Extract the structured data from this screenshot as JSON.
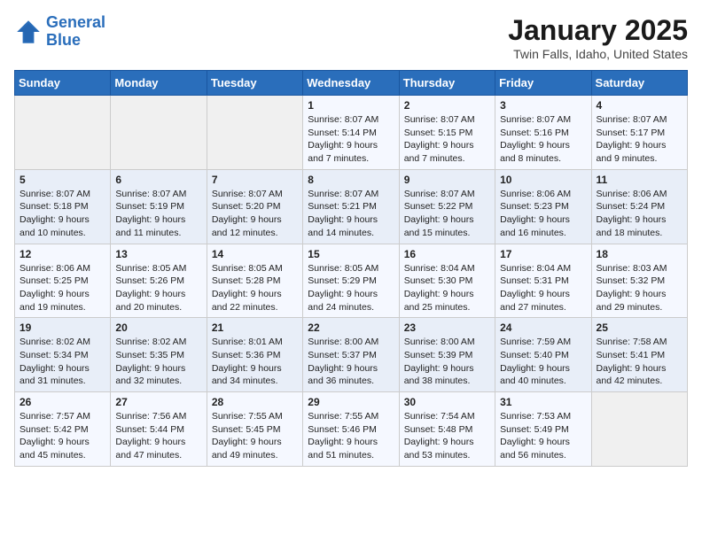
{
  "header": {
    "logo_line1": "General",
    "logo_line2": "Blue",
    "title": "January 2025",
    "subtitle": "Twin Falls, Idaho, United States"
  },
  "weekdays": [
    "Sunday",
    "Monday",
    "Tuesday",
    "Wednesday",
    "Thursday",
    "Friday",
    "Saturday"
  ],
  "weeks": [
    [
      {
        "day": "",
        "info": ""
      },
      {
        "day": "",
        "info": ""
      },
      {
        "day": "",
        "info": ""
      },
      {
        "day": "1",
        "info": "Sunrise: 8:07 AM\nSunset: 5:14 PM\nDaylight: 9 hours\nand 7 minutes."
      },
      {
        "day": "2",
        "info": "Sunrise: 8:07 AM\nSunset: 5:15 PM\nDaylight: 9 hours\nand 7 minutes."
      },
      {
        "day": "3",
        "info": "Sunrise: 8:07 AM\nSunset: 5:16 PM\nDaylight: 9 hours\nand 8 minutes."
      },
      {
        "day": "4",
        "info": "Sunrise: 8:07 AM\nSunset: 5:17 PM\nDaylight: 9 hours\nand 9 minutes."
      }
    ],
    [
      {
        "day": "5",
        "info": "Sunrise: 8:07 AM\nSunset: 5:18 PM\nDaylight: 9 hours\nand 10 minutes."
      },
      {
        "day": "6",
        "info": "Sunrise: 8:07 AM\nSunset: 5:19 PM\nDaylight: 9 hours\nand 11 minutes."
      },
      {
        "day": "7",
        "info": "Sunrise: 8:07 AM\nSunset: 5:20 PM\nDaylight: 9 hours\nand 12 minutes."
      },
      {
        "day": "8",
        "info": "Sunrise: 8:07 AM\nSunset: 5:21 PM\nDaylight: 9 hours\nand 14 minutes."
      },
      {
        "day": "9",
        "info": "Sunrise: 8:07 AM\nSunset: 5:22 PM\nDaylight: 9 hours\nand 15 minutes."
      },
      {
        "day": "10",
        "info": "Sunrise: 8:06 AM\nSunset: 5:23 PM\nDaylight: 9 hours\nand 16 minutes."
      },
      {
        "day": "11",
        "info": "Sunrise: 8:06 AM\nSunset: 5:24 PM\nDaylight: 9 hours\nand 18 minutes."
      }
    ],
    [
      {
        "day": "12",
        "info": "Sunrise: 8:06 AM\nSunset: 5:25 PM\nDaylight: 9 hours\nand 19 minutes."
      },
      {
        "day": "13",
        "info": "Sunrise: 8:05 AM\nSunset: 5:26 PM\nDaylight: 9 hours\nand 20 minutes."
      },
      {
        "day": "14",
        "info": "Sunrise: 8:05 AM\nSunset: 5:28 PM\nDaylight: 9 hours\nand 22 minutes."
      },
      {
        "day": "15",
        "info": "Sunrise: 8:05 AM\nSunset: 5:29 PM\nDaylight: 9 hours\nand 24 minutes."
      },
      {
        "day": "16",
        "info": "Sunrise: 8:04 AM\nSunset: 5:30 PM\nDaylight: 9 hours\nand 25 minutes."
      },
      {
        "day": "17",
        "info": "Sunrise: 8:04 AM\nSunset: 5:31 PM\nDaylight: 9 hours\nand 27 minutes."
      },
      {
        "day": "18",
        "info": "Sunrise: 8:03 AM\nSunset: 5:32 PM\nDaylight: 9 hours\nand 29 minutes."
      }
    ],
    [
      {
        "day": "19",
        "info": "Sunrise: 8:02 AM\nSunset: 5:34 PM\nDaylight: 9 hours\nand 31 minutes."
      },
      {
        "day": "20",
        "info": "Sunrise: 8:02 AM\nSunset: 5:35 PM\nDaylight: 9 hours\nand 32 minutes."
      },
      {
        "day": "21",
        "info": "Sunrise: 8:01 AM\nSunset: 5:36 PM\nDaylight: 9 hours\nand 34 minutes."
      },
      {
        "day": "22",
        "info": "Sunrise: 8:00 AM\nSunset: 5:37 PM\nDaylight: 9 hours\nand 36 minutes."
      },
      {
        "day": "23",
        "info": "Sunrise: 8:00 AM\nSunset: 5:39 PM\nDaylight: 9 hours\nand 38 minutes."
      },
      {
        "day": "24",
        "info": "Sunrise: 7:59 AM\nSunset: 5:40 PM\nDaylight: 9 hours\nand 40 minutes."
      },
      {
        "day": "25",
        "info": "Sunrise: 7:58 AM\nSunset: 5:41 PM\nDaylight: 9 hours\nand 42 minutes."
      }
    ],
    [
      {
        "day": "26",
        "info": "Sunrise: 7:57 AM\nSunset: 5:42 PM\nDaylight: 9 hours\nand 45 minutes."
      },
      {
        "day": "27",
        "info": "Sunrise: 7:56 AM\nSunset: 5:44 PM\nDaylight: 9 hours\nand 47 minutes."
      },
      {
        "day": "28",
        "info": "Sunrise: 7:55 AM\nSunset: 5:45 PM\nDaylight: 9 hours\nand 49 minutes."
      },
      {
        "day": "29",
        "info": "Sunrise: 7:55 AM\nSunset: 5:46 PM\nDaylight: 9 hours\nand 51 minutes."
      },
      {
        "day": "30",
        "info": "Sunrise: 7:54 AM\nSunset: 5:48 PM\nDaylight: 9 hours\nand 53 minutes."
      },
      {
        "day": "31",
        "info": "Sunrise: 7:53 AM\nSunset: 5:49 PM\nDaylight: 9 hours\nand 56 minutes."
      },
      {
        "day": "",
        "info": ""
      }
    ]
  ]
}
